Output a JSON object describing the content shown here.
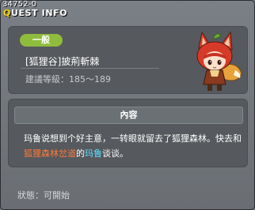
{
  "window": {
    "quest_id": "34752-0",
    "title_first": "Q",
    "title_rest": "UEST INFO"
  },
  "quest": {
    "category_tag": "一般",
    "name": "[狐狸谷]披荊斬棘",
    "level_label": "建議等級：",
    "level_range": "185～189"
  },
  "content": {
    "header": "內容",
    "desc_part1": "玛鲁说想到个好主意，一转眼就留去了狐狸森林。快去和",
    "desc_place": "狐狸森林岔道",
    "desc_part2": "的",
    "desc_npc": "玛鲁",
    "desc_part3": "谈谈。"
  },
  "status": {
    "label": "狀態：",
    "value": "可開始"
  },
  "icons": {
    "npc": "fox-girl-npc-portrait"
  },
  "colors": {
    "tag": "#8fbc3c",
    "place_highlight": "#ff7a3a",
    "npc_highlight": "#5ce1ff",
    "title_accent": "#ffd700"
  }
}
